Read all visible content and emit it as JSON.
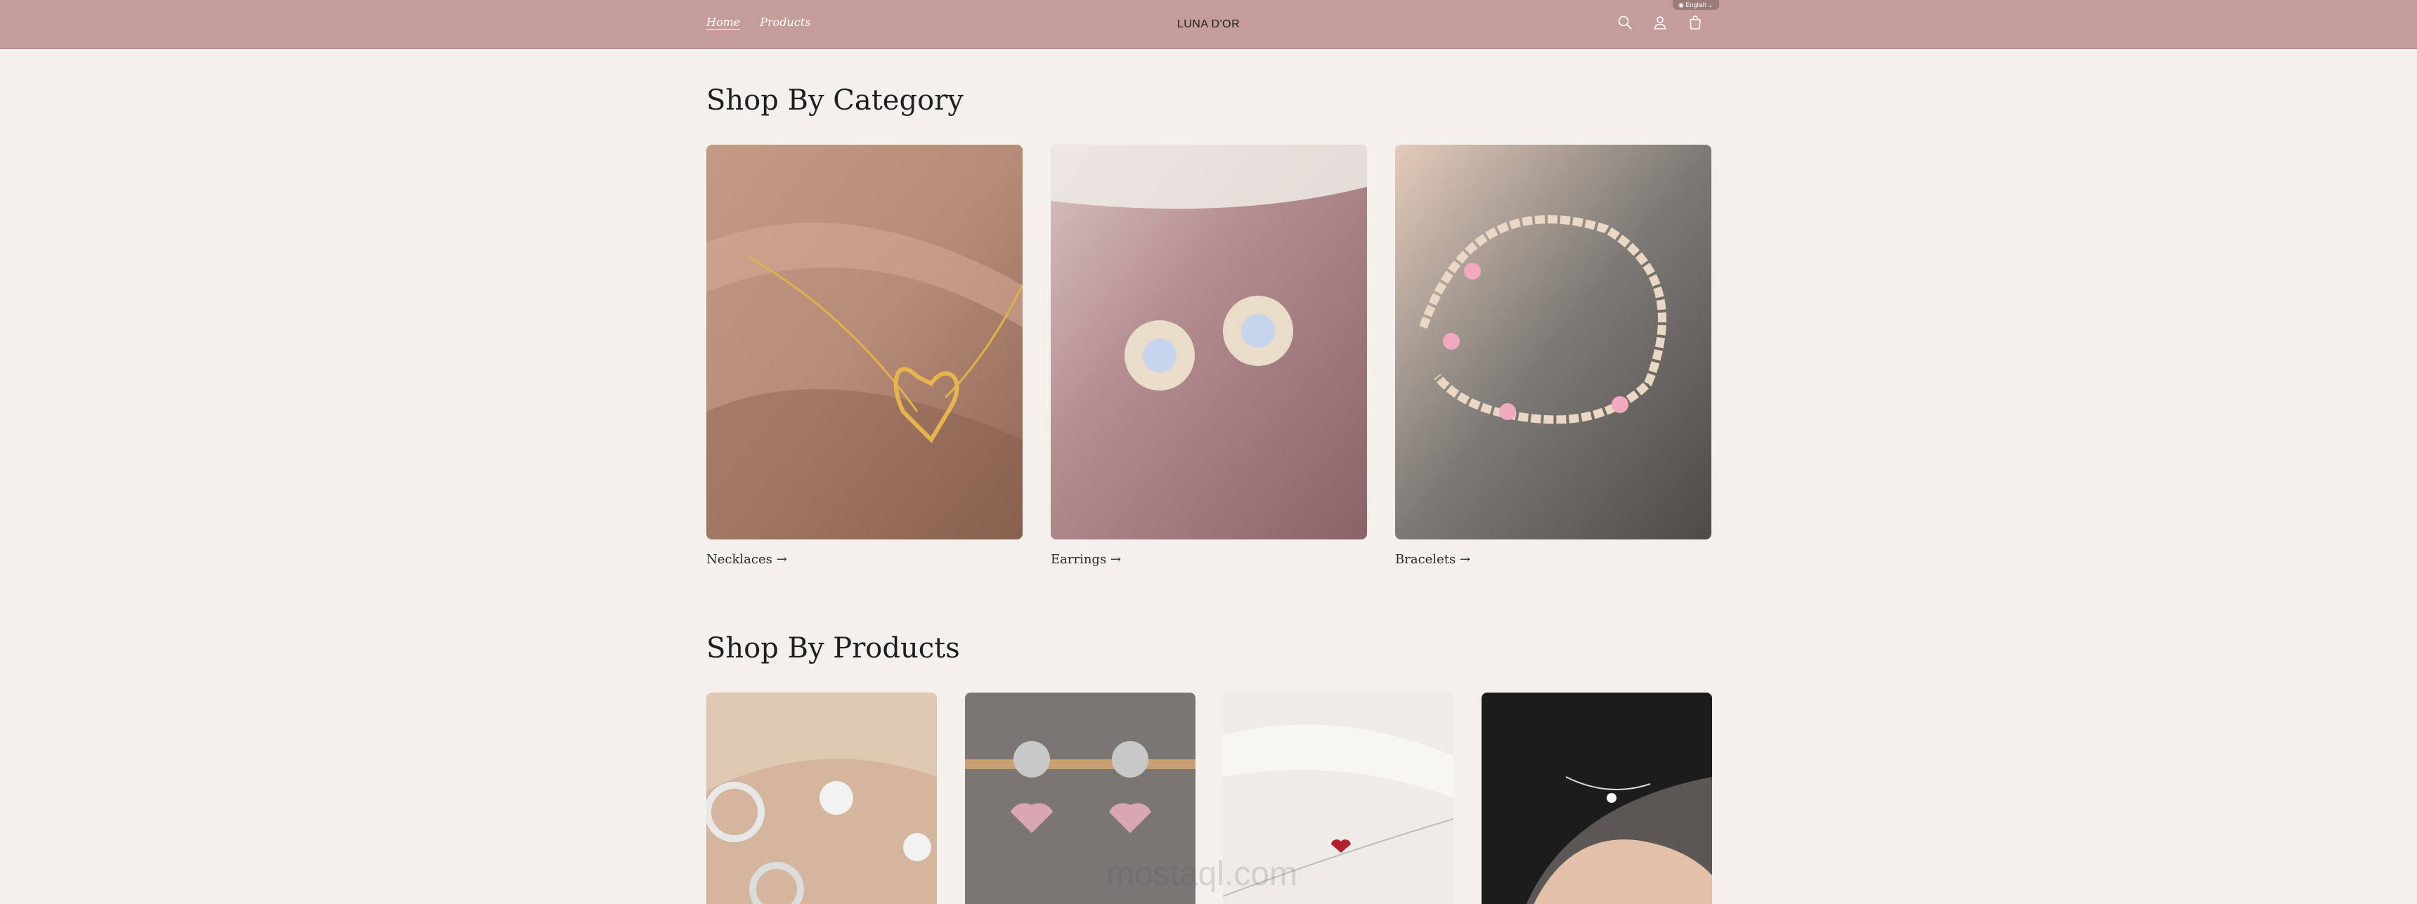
{
  "header": {
    "nav": [
      {
        "label": "Home",
        "active": true
      },
      {
        "label": "Products",
        "active": false
      }
    ],
    "logo": "LUNA D'OR",
    "language": "English",
    "icons": [
      "search-icon",
      "account-icon",
      "cart-icon"
    ],
    "background_color": "#c49c9a"
  },
  "categories_section": {
    "title": "Shop By Category",
    "items": [
      {
        "label": "Necklaces →"
      },
      {
        "label": "Earrings →"
      },
      {
        "label": "Bracelets →"
      }
    ]
  },
  "products_section": {
    "title": "Shop By Products",
    "items": [
      {
        "image": "silver flower hoop earrings"
      },
      {
        "image": "pink heart crystal drop earrings"
      },
      {
        "image": "red heart chain bracelet"
      },
      {
        "image": "silver chain bracelet on wrist"
      }
    ]
  },
  "watermark": "mostaql.com"
}
